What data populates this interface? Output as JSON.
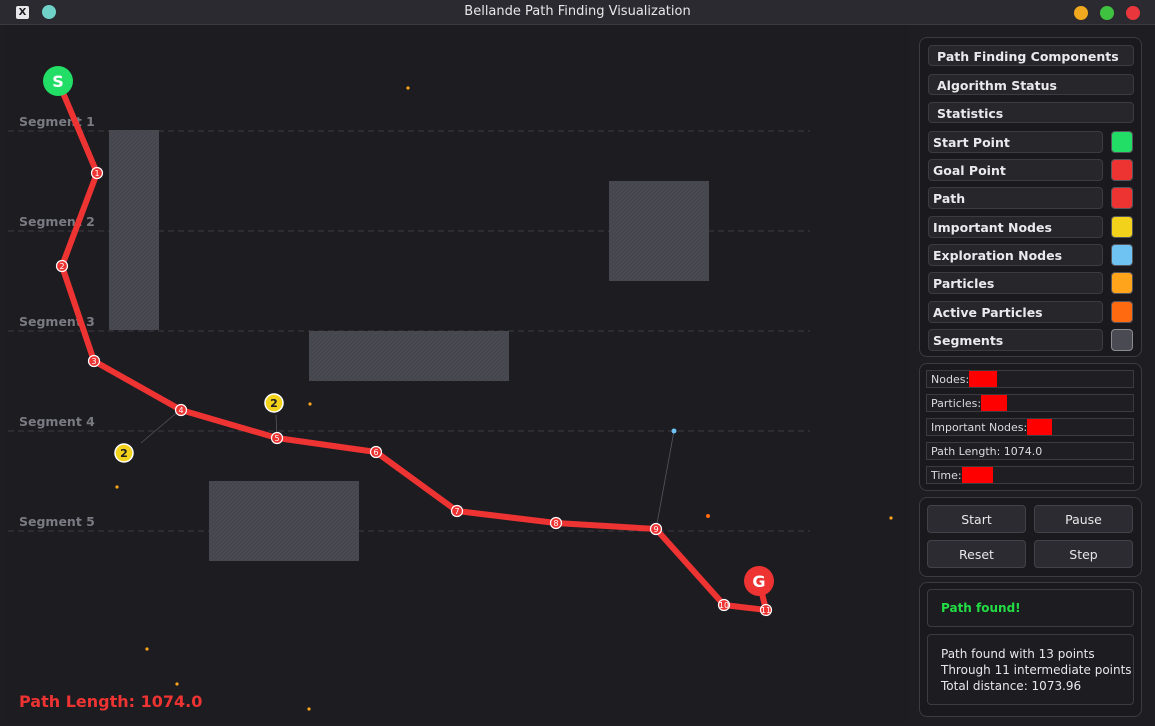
{
  "window": {
    "title": "Bellande Path Finding Visualization",
    "app_icon": "X"
  },
  "canvas": {
    "segments": [
      "Segment 1",
      "Segment 2",
      "Segment 3",
      "Segment 4",
      "Segment 5"
    ],
    "start_label": "S",
    "goal_label": "G",
    "path_nodes": [
      "1",
      "2",
      "3",
      "4",
      "5",
      "6",
      "7",
      "8",
      "9",
      "10",
      "11"
    ],
    "important_node_labels": [
      "2",
      "2"
    ],
    "path_length_text": "Path Length: 1074.0"
  },
  "sidebar": {
    "headers": [
      "Path Finding Components",
      "Algorithm Status",
      "Statistics"
    ],
    "legend": [
      {
        "label": "Start Point",
        "color": "#22dd66"
      },
      {
        "label": "Goal Point",
        "color": "#ee3333"
      },
      {
        "label": "Path",
        "color": "#ee3333"
      },
      {
        "label": "Important Nodes",
        "color": "#f2d21b"
      },
      {
        "label": "Exploration Nodes",
        "color": "#6fc3f2"
      },
      {
        "label": "Particles",
        "color": "#ffa41b"
      },
      {
        "label": "Active Particles",
        "color": "#ff6a10"
      },
      {
        "label": "Segments",
        "color": "#4a4a52"
      }
    ],
    "stats": {
      "nodes": "Nodes:",
      "particles": "Particles:",
      "important_nodes": "Important Nodes:",
      "path_length": "Path Length: 1074.0",
      "time": "Time:"
    },
    "buttons": {
      "start": "Start",
      "pause": "Pause",
      "reset": "Reset",
      "step": "Step"
    },
    "status": "Path found!",
    "details": [
      "Path found with 13 points",
      "Through 11 intermediate points",
      "Total distance: 1073.96"
    ]
  },
  "colors": {
    "path": "#ee3333",
    "start": "#22dd66",
    "goal": "#ee3333",
    "important": "#f2d21b",
    "status_text": "#22dd44"
  }
}
